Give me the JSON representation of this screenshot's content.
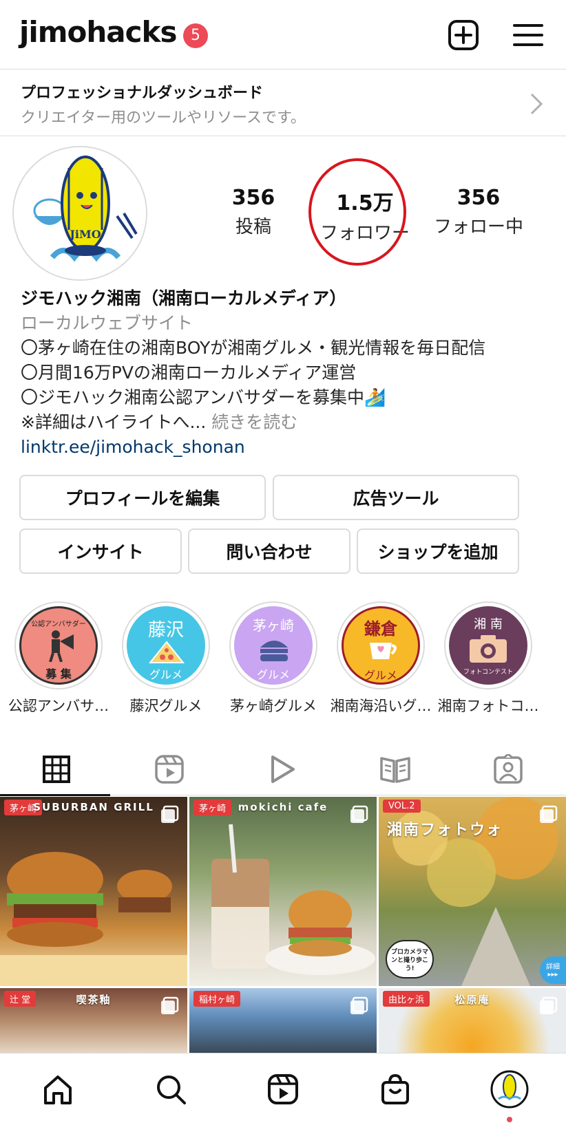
{
  "header": {
    "username": "jimohacks",
    "notification_count": "5"
  },
  "dashboard": {
    "title": "プロフェッショナルダッシュボード",
    "subtitle": "クリエイター用のツールやリソースです。"
  },
  "stats": {
    "posts_count": "356",
    "posts_label": "投稿",
    "followers_count": "1.5万",
    "followers_label": "フォロワー",
    "following_count": "356",
    "following_label": "フォロー中"
  },
  "bio": {
    "name": "ジモハック湘南（湘南ローカルメディア）",
    "category": "ローカルウェブサイト",
    "line1": "〇茅ヶ崎在住の湘南BOYが湘南グルメ・観光情報を毎日配信",
    "line2": "〇月間16万PVの湘南ローカルメディア運営",
    "line3": "〇ジモハック湘南公認アンバサダーを募集中🏄",
    "line4": "※詳細はハイライトへ...",
    "more": "続きを読む",
    "link": "linktr.ee/jimohack_shonan"
  },
  "buttons": {
    "edit_profile": "プロフィールを編集",
    "ad_tools": "広告ツール",
    "insights": "インサイト",
    "contact": "問い合わせ",
    "add_shop": "ショップを追加"
  },
  "highlights": [
    {
      "label": "公認アンバサ…",
      "cover_top": "公認アンバサダー",
      "cover_bottom": "募 集",
      "color": "#ef8b80"
    },
    {
      "label": "藤沢グルメ",
      "cover_top": "藤沢",
      "cover_bottom": "グルメ",
      "color": "#46c6e6"
    },
    {
      "label": "茅ヶ崎グルメ",
      "cover_top": "茅ヶ崎",
      "cover_bottom": "グルメ",
      "color": "#c9a5f2"
    },
    {
      "label": "湘南海沿いグ…",
      "cover_top": "鎌倉",
      "cover_bottom": "グルメ",
      "color": "#f7b928"
    },
    {
      "label": "湘南フォトコ…",
      "cover_top": "湘 南",
      "cover_bottom": "フォトコンテスト",
      "color": "#6a3d5c"
    }
  ],
  "grid": [
    {
      "tag": "茅ヶ崎",
      "title": "SUBURBAN GRILL"
    },
    {
      "tag": "茅ヶ崎",
      "title": "mokichi cafe"
    },
    {
      "tag": "VOL.2",
      "title": "湘南フォトウォ",
      "bubble": "プロカメラマンと撮り歩こう!",
      "detail": "詳細 ▸▸▸"
    },
    {
      "tag": "辻 堂",
      "title": "喫茶釉"
    },
    {
      "tag": "稲村ヶ崎",
      "title": ""
    },
    {
      "tag": "由比ヶ浜",
      "title": "松原庵"
    }
  ],
  "avatar": {
    "logo_text": "JiMO"
  },
  "colors": {
    "accent_red": "#ed4956",
    "link_blue": "#00376b",
    "circle_red": "#d8161e"
  }
}
